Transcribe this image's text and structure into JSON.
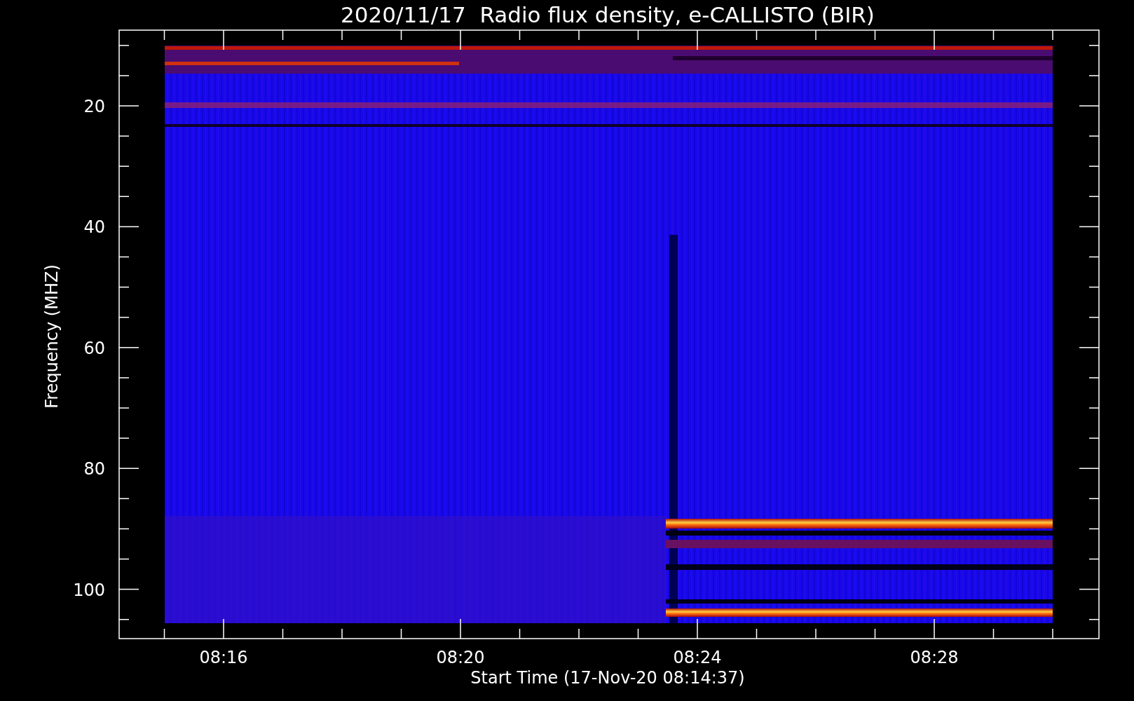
{
  "plot": {
    "title": "2020/11/17  Radio flux density, e-CALLISTO (BIR)",
    "y_axis": {
      "label": "Frequency (MHZ)",
      "ticks": [
        "20",
        "40",
        "60",
        "80",
        "100"
      ]
    },
    "x_axis": {
      "label": "Start Time (17-Nov-20 08:14:37)",
      "ticks": [
        "08:16",
        "08:20",
        "08:24",
        "08:28"
      ]
    }
  }
}
